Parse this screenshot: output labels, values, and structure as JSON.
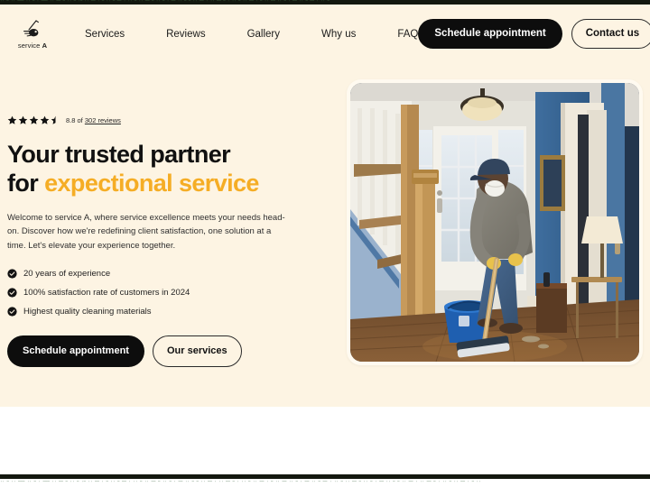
{
  "brand": {
    "logo_icon": "vacuum-icon",
    "name_light": "service",
    "name_bold": "A"
  },
  "nav": {
    "items": [
      {
        "label": "Services"
      },
      {
        "label": "Reviews"
      },
      {
        "label": "Gallery"
      },
      {
        "label": "Why us"
      },
      {
        "label": "FAQ"
      }
    ]
  },
  "header": {
    "schedule_label": "Schedule appointment",
    "contact_label": "Contact us"
  },
  "hero": {
    "rating": {
      "stars_icon": "star-icon",
      "half_star_icon": "star-half-icon",
      "filled_stars": 4,
      "half_star": true,
      "score": "8.8",
      "text_prefix": "8.8 of",
      "reviews_link": "302 reviews"
    },
    "headline_line1": "Your trusted partner",
    "headline_line2_lead": "for ",
    "headline_line2_accent": "expectional service",
    "accent_color": "#f5ad25",
    "paragraph": "Welcome to service A, where service excellence meets your needs head-on. Discover how we're redefining client satisfaction, one solution at a time. Let's elevate your experience together.",
    "features": [
      {
        "icon": "check-circle-icon",
        "label": "20 years of experience"
      },
      {
        "icon": "check-circle-icon",
        "label": "100% satisfaction rate of customers in 2024"
      },
      {
        "icon": "check-circle-icon",
        "label": "Highest quality cleaning materials"
      }
    ],
    "cta_primary": "Schedule appointment",
    "cta_secondary": "Our services",
    "image_alt": "Person in mask mopping a hardwood hallway floor beside a blue bucket"
  },
  "theme": {
    "background": "#fdf4e3",
    "page_background": "#ffffff",
    "dark": "#0d0d0d",
    "text": "#111111"
  }
}
